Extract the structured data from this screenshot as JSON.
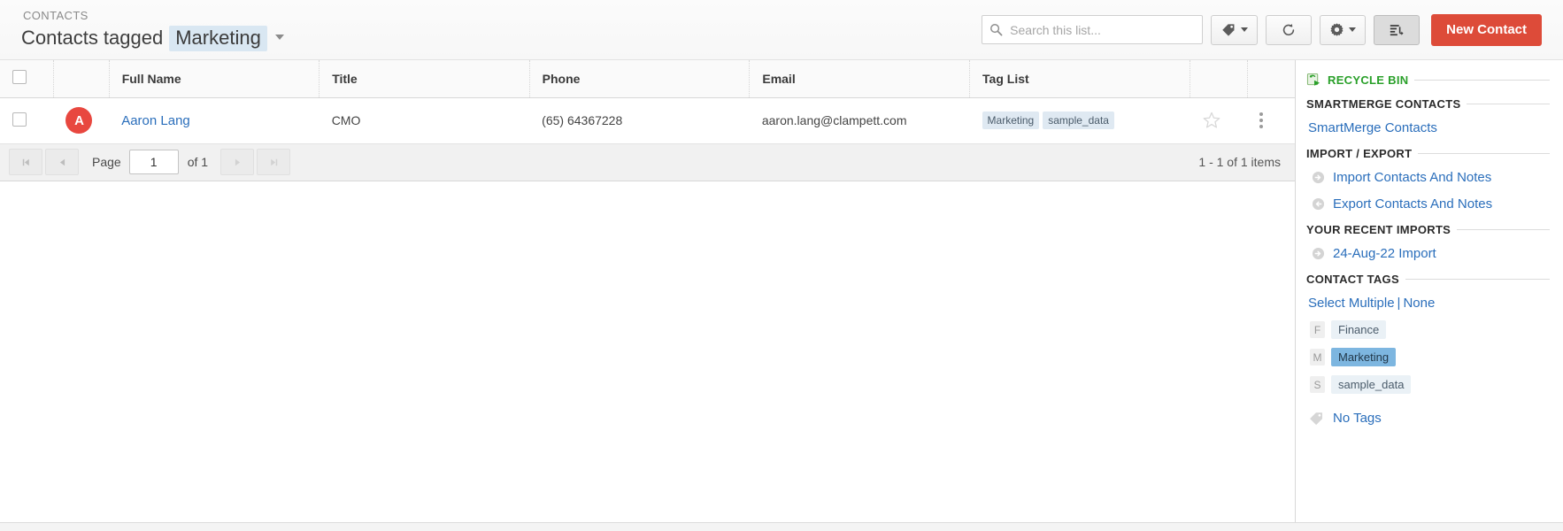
{
  "header": {
    "breadcrumb": "CONTACTS",
    "title_prefix": "Contacts tagged",
    "title_tag": "Marketing",
    "caret_icon": "chevron-down-icon",
    "search": {
      "placeholder": "Search this list...",
      "value": "",
      "icon": "search-icon"
    },
    "buttons": {
      "tag": {
        "icon": "tag-icon",
        "label": ""
      },
      "refresh": {
        "icon": "refresh-icon",
        "label": ""
      },
      "settings": {
        "icon": "gear-icon",
        "label": ""
      },
      "sort": {
        "icon": "sort-list-icon",
        "label": ""
      },
      "new_contact": "New Contact"
    }
  },
  "table": {
    "columns": [
      "",
      "",
      "Full Name",
      "Title",
      "Phone",
      "Email",
      "Tag List",
      "",
      ""
    ],
    "rows": [
      {
        "avatar_letter": "A",
        "avatar_color": "#e8473f",
        "full_name": "Aaron Lang",
        "title": "CMO",
        "phone": "(65) 64367228",
        "email": "aaron.lang@clampett.com",
        "tags": [
          "Marketing",
          "sample_data"
        ],
        "star_icon": "star-outline-icon",
        "menu_icon": "kebab-menu-icon"
      }
    ]
  },
  "pagination": {
    "first_icon": "first-page-icon",
    "prev_icon": "prev-page-icon",
    "page_label": "Page",
    "page_value": "1",
    "of_label": "of 1",
    "next_icon": "next-page-icon",
    "last_icon": "last-page-icon",
    "count_text": "1 - 1 of 1 items"
  },
  "sidebar": {
    "recycle_bin": {
      "label": "RECYCLE BIN",
      "icon": "recycle-bin-icon",
      "color": "#2aa02a"
    },
    "sections": [
      {
        "heading": "SMARTMERGE CONTACTS",
        "links": [
          {
            "label": "SmartMerge Contacts",
            "icon": ""
          }
        ]
      },
      {
        "heading": "IMPORT / EXPORT",
        "links": [
          {
            "label": "Import Contacts And Notes",
            "icon": "arrow-right-circle-icon"
          },
          {
            "label": "Export Contacts And Notes",
            "icon": "arrow-left-circle-icon"
          }
        ]
      },
      {
        "heading": "YOUR RECENT IMPORTS",
        "links": [
          {
            "label": "24-Aug-22 Import",
            "icon": "arrow-right-circle-icon"
          }
        ]
      }
    ],
    "contact_tags": {
      "heading": "CONTACT TAGS",
      "select_multiple": "Select Multiple",
      "separator": "|",
      "none": "None",
      "tags": [
        {
          "letter": "F",
          "label": "Finance",
          "selected": false
        },
        {
          "letter": "M",
          "label": "Marketing",
          "selected": true
        },
        {
          "letter": "S",
          "label": "sample_data",
          "selected": false
        }
      ],
      "no_tags": {
        "label": "No Tags",
        "icon": "tag-outline-icon"
      }
    }
  },
  "colors": {
    "accent_red": "#dd4b39",
    "link_blue": "#2a6ebb",
    "tag_selected": "#7db6e0",
    "recycle_green": "#2aa02a"
  }
}
